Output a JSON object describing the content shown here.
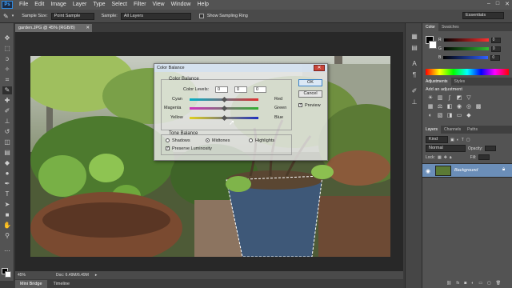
{
  "app": {
    "logo": "Ps"
  },
  "menu": [
    "File",
    "Edit",
    "Image",
    "Layer",
    "Type",
    "Select",
    "Filter",
    "View",
    "Window",
    "Help"
  ],
  "window_controls": [
    "–",
    "□",
    "✕"
  ],
  "options_bar": {
    "sample_size_label": "Sample Size:",
    "sample_size_value": "Point Sample",
    "sample_label": "Sample:",
    "sample_value": "All Layers",
    "show_ring_label": "Show Sampling Ring",
    "workspace": "Essentials"
  },
  "document": {
    "tab_title": "garden.JPG @ 45% (RGB/8)",
    "zoom": "45%",
    "doc_size": "Doc: 6.49M/6.49M"
  },
  "bottom_tabs": [
    "Mini Bridge",
    "Timeline"
  ],
  "color_panel": {
    "tabs": [
      "Color",
      "Swatches"
    ],
    "r_label": "R",
    "r_value": "0",
    "g_label": "G",
    "g_value": "0",
    "b_label": "B",
    "b_value": "0",
    "colors": {
      "r_track": "#ff3030",
      "g_track": "#30c030",
      "b_track": "#3060ff"
    }
  },
  "adjustments_panel": {
    "tabs": [
      "Adjustments",
      "Styles"
    ],
    "hint": "Add an adjustment"
  },
  "layers_panel": {
    "tabs": [
      "Layers",
      "Channels",
      "Paths"
    ],
    "filter": "Kind",
    "blend_mode": "Normal",
    "opacity_label": "Opacity:",
    "lock_label": "Lock:",
    "fill_label": "Fill:",
    "layer_name": "Background"
  },
  "dialog": {
    "title": "Color Balance",
    "color_balance_group": "Color Balance",
    "color_levels_label": "Color Levels:",
    "levels": [
      "0",
      "0",
      "0"
    ],
    "sliders": [
      {
        "left": "Cyan",
        "right": "Red",
        "value": 0
      },
      {
        "left": "Magenta",
        "right": "Green",
        "value": 0
      },
      {
        "left": "Yellow",
        "right": "Blue",
        "value": 0
      }
    ],
    "tone_group": "Tone Balance",
    "tones": [
      "Shadows",
      "Midtones",
      "Highlights"
    ],
    "selected_tone": "Midtones",
    "preserve_label": "Preserve Luminosity",
    "ok_label": "OK",
    "cancel_label": "Cancel",
    "preview_label": "Preview"
  }
}
